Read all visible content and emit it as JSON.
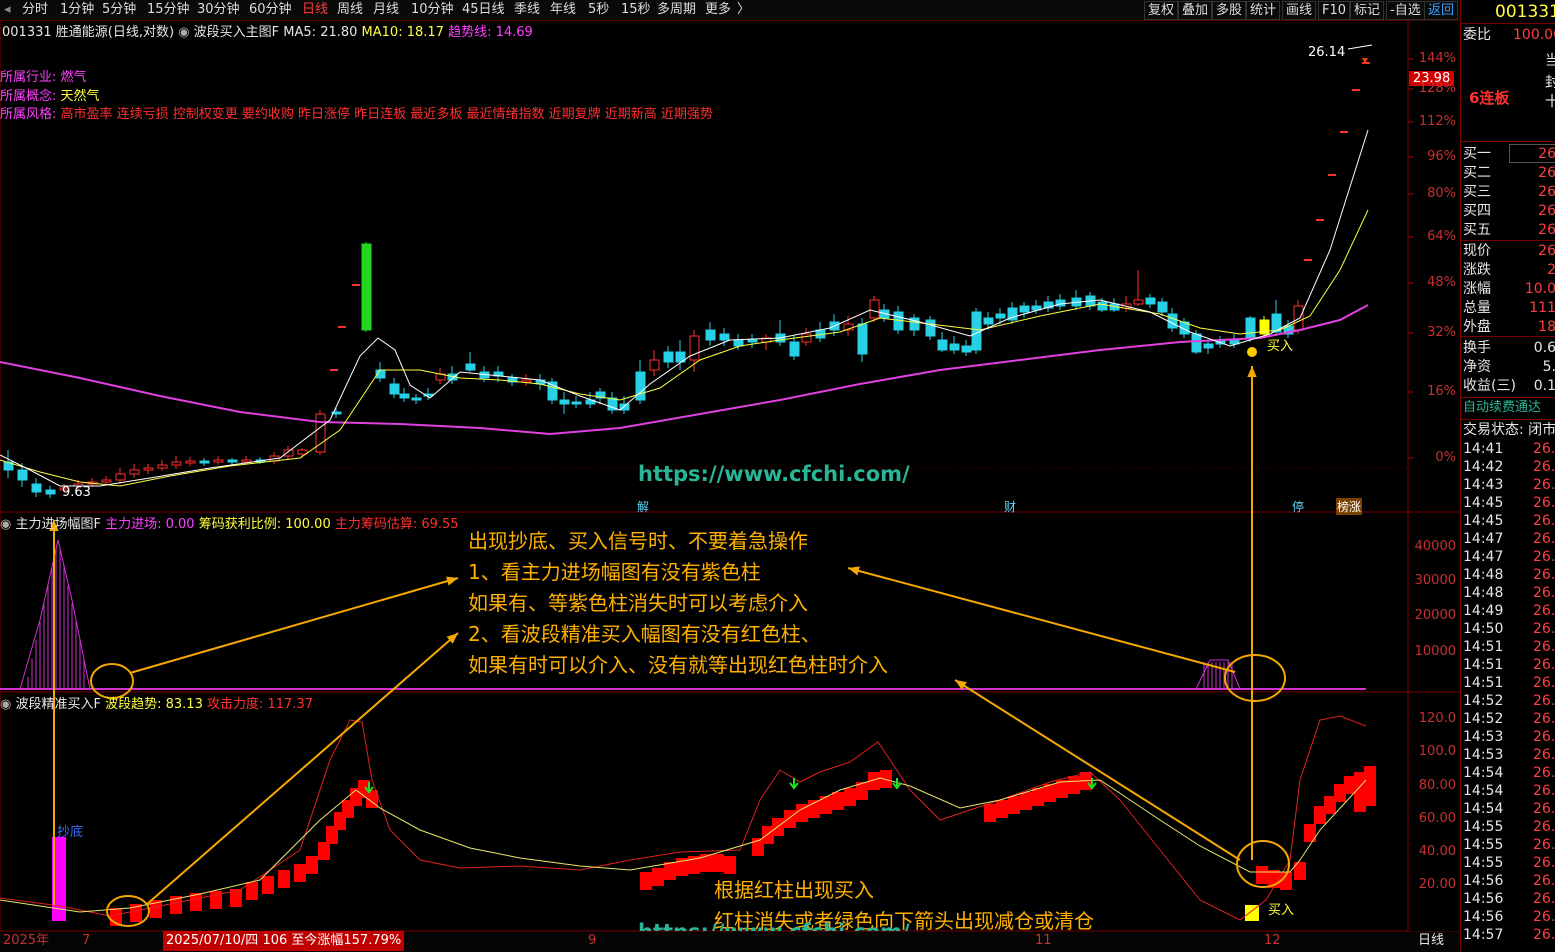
{
  "toolbar": {
    "periods": [
      "分时",
      "1分钟",
      "5分钟",
      "15分钟",
      "30分钟",
      "60分钟",
      "日线",
      "周线",
      "月线",
      "10分钟",
      "45日线",
      "季线",
      "年线",
      "5秒",
      "15秒",
      "多周期",
      "更多"
    ],
    "active_period": "日线",
    "right_buttons": [
      "复权",
      "叠加",
      "多股",
      "统计",
      "画线",
      "F10",
      "标记",
      "-自选",
      "返回"
    ]
  },
  "stock": {
    "code_name": "001331 胜通能源(日线,对数)",
    "indicator": "波段买入主图F",
    "ma5": "MA5: 21.80",
    "ma10": "MA10: 18.17",
    "trend": "趋势线: 14.69",
    "industry_label": "所属行业:",
    "industry": "燃气",
    "concept_label": "所属概念:",
    "concept": "天然气",
    "style_label": "所属风格:",
    "style": "高市盈率 连续亏损 控制权变更 要约收购 昨日涨停 昨日连板 最近多板 最近情绪指数 近期复牌 近期新高 近期强势",
    "high_label": "26.14",
    "low_label": "9.63",
    "buy_label": "买入",
    "price_tag": "23.98",
    "event_tags": [
      "解",
      "财",
      "停",
      "榜涨"
    ]
  },
  "axis_main": [
    "144%",
    "128%",
    "112%",
    "96%",
    "80%",
    "64%",
    "48%",
    "32%",
    "16%",
    "0%"
  ],
  "panel2": {
    "title": "主力进场幅图F",
    "f1": "主力进场: 0.00",
    "f2": "筹码获利比例: 100.00",
    "f3": "主力筹码估算: 69.55",
    "axis": [
      "40000",
      "30000",
      "20000",
      "10000"
    ]
  },
  "panel3": {
    "title": "波段精准买入F",
    "f1": "波段趋势: 83.13",
    "f2": "攻击力度: 117.37",
    "axis": [
      "120.0",
      "100.0",
      "80.00",
      "60.00",
      "40.00",
      "20.00"
    ],
    "bottom_label": "抄底",
    "buy_label": "买入"
  },
  "annotations": {
    "main": [
      "出现抄底、买入信号时、不要着急操作",
      "1、看主力进场幅图有没有紫色柱",
      "如果有、等紫色柱消失时可以考虑介入",
      "2、看波段精准买入幅图有没有红色柱、",
      "如果有时可以介入、没有就等出现红色柱时介入"
    ],
    "bottom": [
      "根据红柱出现买入",
      "红柱消失或者绿色向下箭头出现减仓或清仓"
    ],
    "watermark": "https://www.cfchi.com/"
  },
  "bottom_bar": {
    "year": "2025年",
    "m7": "7",
    "date_info": "2025/07/10/四 106 至今涨幅157.79%",
    "m9": "9",
    "m11": "11",
    "m12": "12",
    "period": "日线"
  },
  "right_panel": {
    "code": "001331",
    "wei_label": "委比",
    "wei_val": "100.00",
    "dang": "当",
    "feng": "封",
    "shi": "十",
    "lianban": "6连板",
    "buy_rows": [
      {
        "label": "买一",
        "val": "26"
      },
      {
        "label": "买二",
        "val": "26"
      },
      {
        "label": "买三",
        "val": "26"
      },
      {
        "label": "买四",
        "val": "26"
      },
      {
        "label": "买五",
        "val": "26"
      }
    ],
    "quote_rows": [
      {
        "label": "现价",
        "val": "26"
      },
      {
        "label": "涨跌",
        "val": "2"
      },
      {
        "label": "涨幅",
        "val": "10.0"
      },
      {
        "label": "总量",
        "val": "111"
      },
      {
        "label": "外盘",
        "val": "18"
      }
    ],
    "stats_rows": [
      {
        "label": "换手",
        "val": "0.6"
      },
      {
        "label": "净资",
        "val": "5."
      },
      {
        "label": "收益(三)",
        "val": "0.1"
      }
    ],
    "auto_renew": "自动续费通达",
    "trade_status": "交易状态: 闭市",
    "ticks": [
      "14:41",
      "14:42",
      "14:43",
      "14:45",
      "14:45",
      "14:47",
      "14:47",
      "14:48",
      "14:48",
      "14:49",
      "14:50",
      "14:51",
      "14:51",
      "14:51",
      "14:52",
      "14:52",
      "14:53",
      "14:53",
      "14:54",
      "14:54",
      "14:54",
      "14:55",
      "14:55",
      "14:55",
      "14:56",
      "14:56",
      "14:56",
      "14:57"
    ],
    "tick_val": "26."
  }
}
